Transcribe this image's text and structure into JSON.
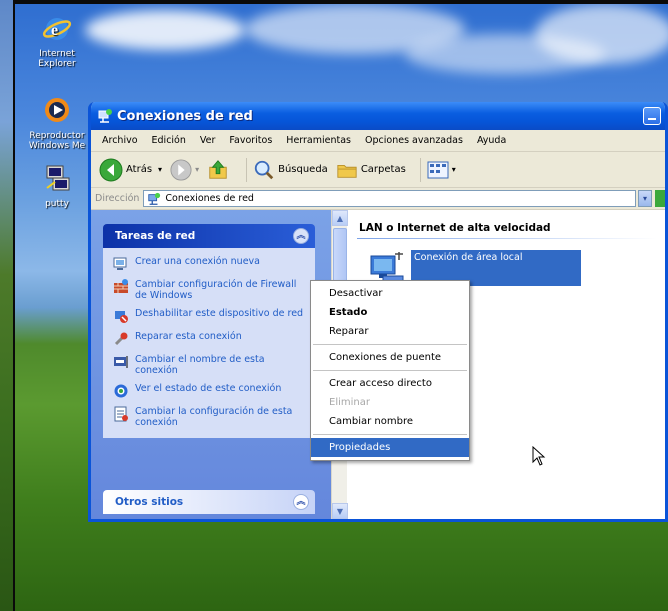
{
  "desktop": {
    "icons": [
      {
        "label": "Internet Explorer",
        "icon": "internet-explorer-icon"
      },
      {
        "label": "Reproductor Windows Me",
        "icon": "media-player-icon"
      },
      {
        "label": "putty",
        "icon": "putty-icon"
      }
    ]
  },
  "window": {
    "title": "Conexiones de red",
    "menu": [
      "Archivo",
      "Edición",
      "Ver",
      "Favoritos",
      "Herramientas",
      "Opciones avanzadas",
      "Ayuda"
    ],
    "toolbar": {
      "back_label": "Atrás",
      "search_label": "Búsqueda",
      "folders_label": "Carpetas"
    },
    "address": {
      "label": "Dirección",
      "value": "Conexiones de red"
    }
  },
  "taskpane": {
    "network_tasks": {
      "title": "Tareas de red",
      "items": [
        {
          "label": "Crear una conexión nueva",
          "icon": "new-connection-icon"
        },
        {
          "label": "Cambiar configuración de Firewall de Windows",
          "icon": "firewall-icon"
        },
        {
          "label": "Deshabilitar este dispositivo de red",
          "icon": "disable-device-icon"
        },
        {
          "label": "Reparar esta conexión",
          "icon": "repair-icon"
        },
        {
          "label": "Cambiar el nombre de esta conexión",
          "icon": "rename-icon"
        },
        {
          "label": "Ver el estado de este conexión",
          "icon": "status-icon"
        },
        {
          "label": "Cambiar la configuración de esta conexión",
          "icon": "settings-icon"
        }
      ]
    },
    "other_places": {
      "title": "Otros sitios"
    }
  },
  "main": {
    "group_title": "LAN o Internet de alta velocidad",
    "connection": {
      "label_line1": "Conexión de área local",
      "label_line2": "",
      "label_line3": ""
    }
  },
  "context_menu": {
    "items": [
      {
        "label": "Desactivar",
        "style": "normal"
      },
      {
        "label": "Estado",
        "style": "bold"
      },
      {
        "label": "Reparar",
        "style": "normal"
      },
      {
        "label": "Conexiones de puente",
        "style": "normal"
      },
      {
        "label": "Crear acceso directo",
        "style": "normal"
      },
      {
        "label": "Eliminar",
        "style": "disabled"
      },
      {
        "label": "Cambiar nombre",
        "style": "normal"
      },
      {
        "label": "Propiedades",
        "style": "highlighted"
      }
    ]
  },
  "colors": {
    "xp_blue_title": "#0a5ee0",
    "selection": "#316ac5",
    "task_link": "#215dc6"
  }
}
